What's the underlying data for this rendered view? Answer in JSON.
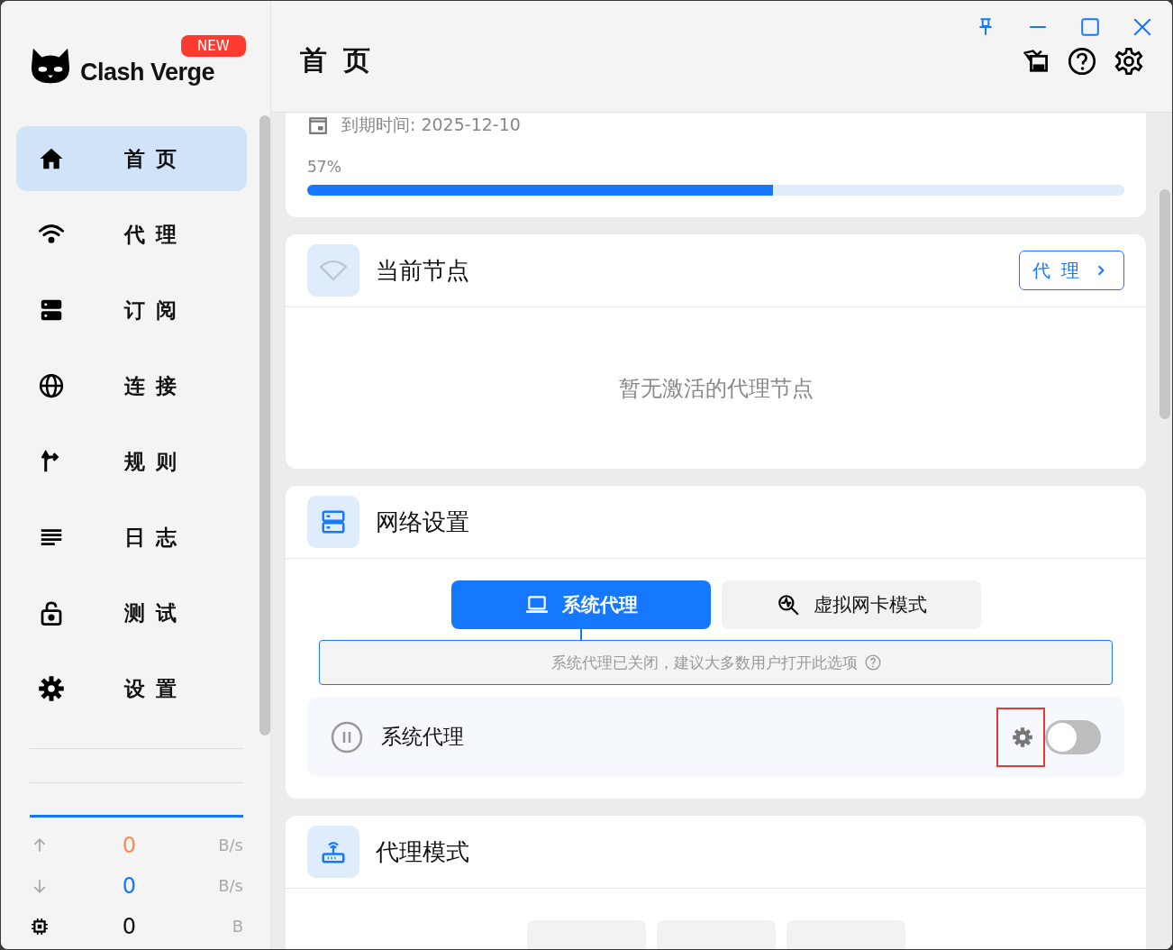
{
  "app": {
    "name": "Clash Verge",
    "badge": "NEW"
  },
  "sidebar": {
    "items": [
      {
        "label": "首 页",
        "selected": true
      },
      {
        "label": "代 理",
        "selected": false
      },
      {
        "label": "订 阅",
        "selected": false
      },
      {
        "label": "连 接",
        "selected": false
      },
      {
        "label": "规 则",
        "selected": false
      },
      {
        "label": "日 志",
        "selected": false
      },
      {
        "label": "测 试",
        "selected": false
      },
      {
        "label": "设 置",
        "selected": false
      }
    ]
  },
  "traffic": [
    {
      "kind": "upload",
      "value": "0",
      "unit": "B/s",
      "color": "#fa8c5c"
    },
    {
      "kind": "download",
      "value": "0",
      "unit": "B/s",
      "color": "#1677ff"
    },
    {
      "kind": "memory",
      "value": "0",
      "unit": "B",
      "color": "#111111"
    }
  ],
  "page_title": "首 页",
  "subscription": {
    "expire": "到期时间: 2025-12-10",
    "percent": "57%",
    "level": 0.57
  },
  "current_node": {
    "title": "当前节点",
    "button": "代 理",
    "empty_text": "暂无激活的代理节点"
  },
  "network": {
    "title": "网络设置",
    "tabs": [
      {
        "label": "系统代理",
        "selected": true
      },
      {
        "label": "虚拟网卡模式",
        "selected": false
      }
    ],
    "hint": "系统代理已关闭，建议大多数用户打开此选项",
    "row": {
      "label": "系统代理",
      "on": false,
      "gear_highlighted": true
    }
  },
  "proxy_mode": {
    "title": "代理模式"
  }
}
